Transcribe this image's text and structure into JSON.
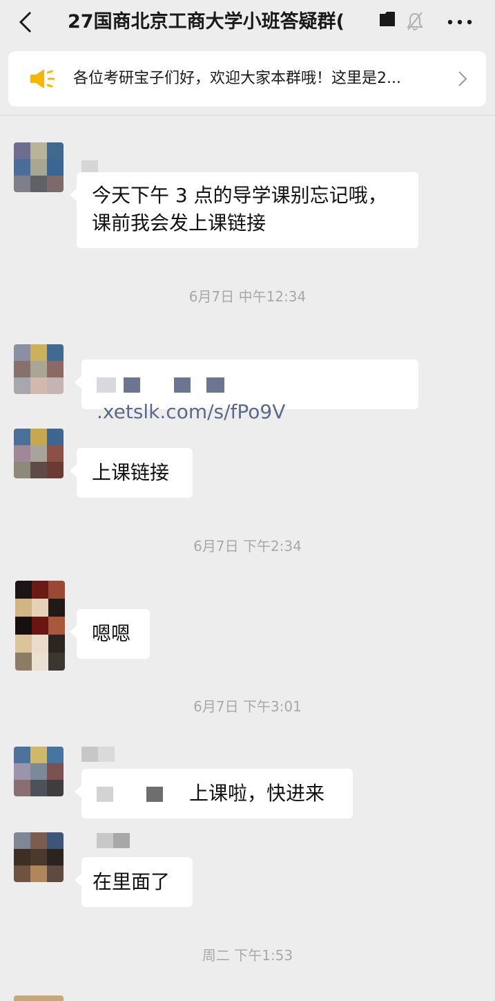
{
  "header": {
    "title": "27国商北京工商大学小班答疑群(",
    "back_icon": "chevron-left-icon",
    "folder_icon": "folder-icon",
    "mute_icon": "bell-muted-icon",
    "more_icon": "more-dots-icon"
  },
  "notice": {
    "icon": "megaphone-icon",
    "text": "各位考研宝子们好，欢迎大家本群哦！这里是2...",
    "accent": "#f5b800"
  },
  "messages": [
    {
      "text_line1": "今天下午 3 点的导学课别忘记哦，",
      "text_line2": "课前我会发上课链接"
    },
    {
      "time": "6月7日 中午12:34"
    },
    {
      "link": ".xetslk.com/s/fPo9V"
    },
    {
      "text": "上课链接"
    },
    {
      "time": "6月7日 下午2:34"
    },
    {
      "text": "嗯嗯"
    },
    {
      "time": "6月7日 下午3:01"
    },
    {
      "text": "上课啦，快进来"
    },
    {
      "text": "在里面了"
    },
    {
      "time": "周二 下午1:53"
    }
  ],
  "colors": {
    "background": "#ededed",
    "bubble": "#ffffff",
    "link": "#5b6a8c",
    "timestamp": "#a8a8a8"
  }
}
